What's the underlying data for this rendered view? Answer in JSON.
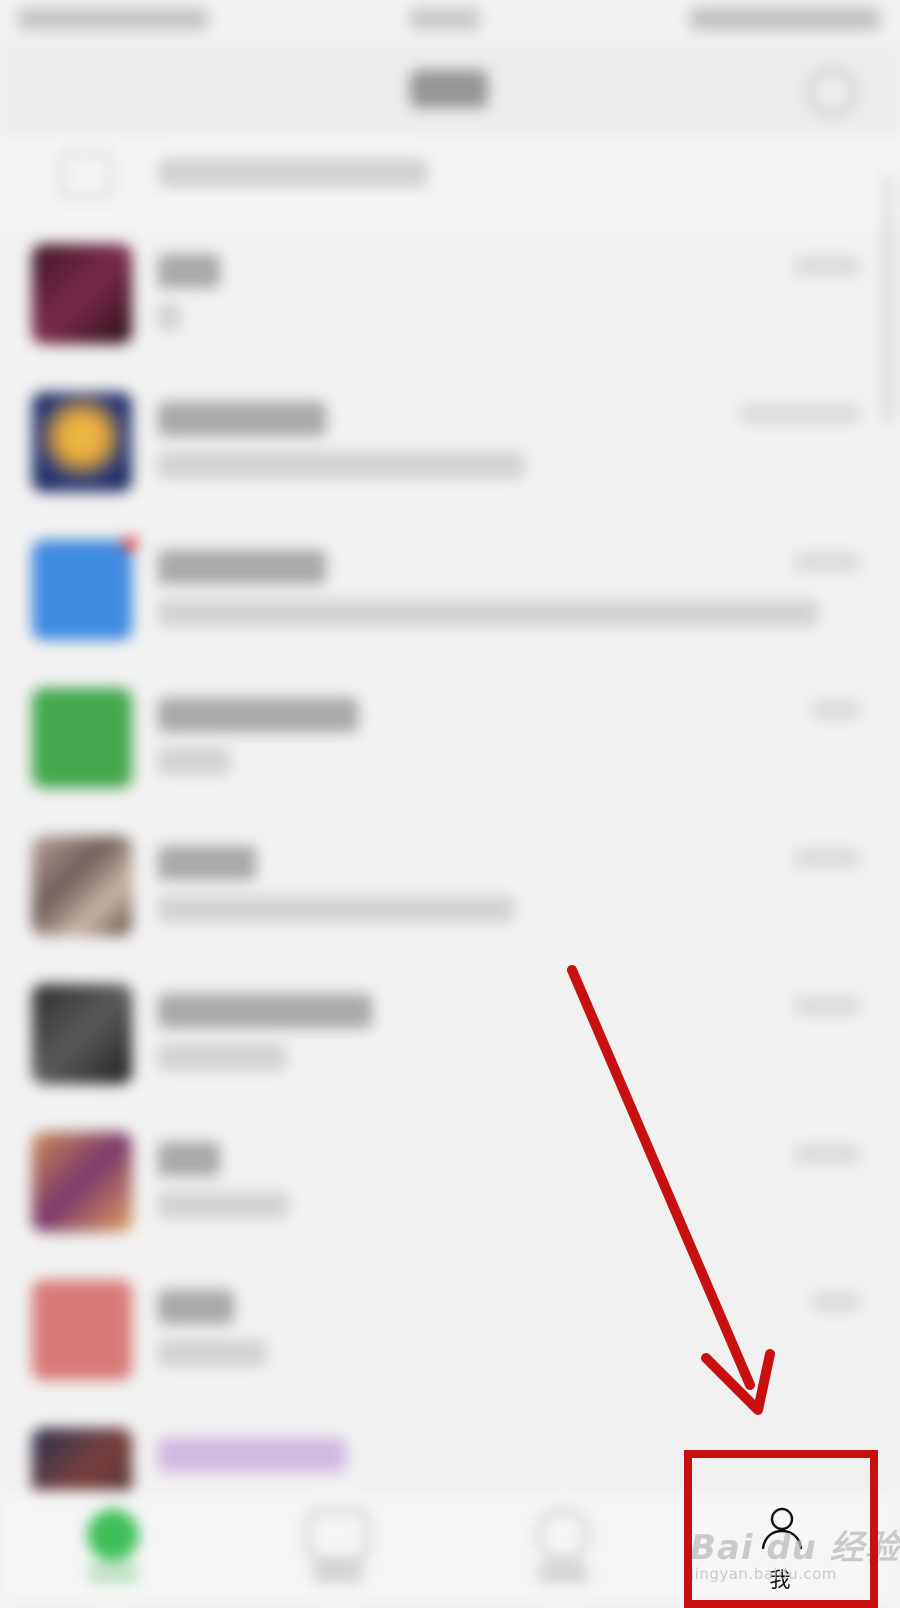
{
  "tab_bar": {
    "me_label": "我"
  },
  "watermark": {
    "line1": "Bai du 经验",
    "line2": "jingyan.baidu.com"
  },
  "colors": {
    "annotation_red": "#c81010",
    "chat_tab_green": "#3fbf5a"
  },
  "icons": {
    "me_tab": "person-icon",
    "add": "plus-circle-icon",
    "pc_notice": "monitor-icon"
  }
}
